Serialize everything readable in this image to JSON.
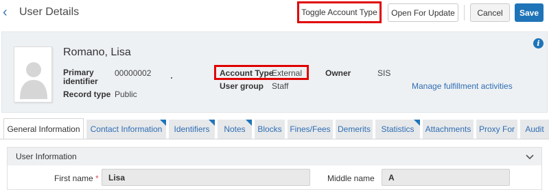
{
  "header": {
    "title": "User Details",
    "buttons": {
      "toggle": "Toggle Account Type",
      "open": "Open For Update",
      "cancel": "Cancel",
      "save": "Save"
    }
  },
  "profile": {
    "name": "Romano, Lisa",
    "fields": {
      "primary_identifier_label": "Primary identifier",
      "primary_identifier_value": "00000002",
      "record_type_label": "Record type",
      "record_type_value": "Public",
      "account_type_label": "Account Type",
      "account_type_value": "External",
      "user_group_label": "User group",
      "user_group_value": "Staff",
      "owner_label": "Owner",
      "owner_value": "SIS"
    },
    "link": "Manage fulfillment activities",
    "info_icon": "i"
  },
  "tabs": [
    {
      "label": "General Information",
      "active": true
    },
    {
      "label": "Contact Information",
      "marked": true
    },
    {
      "label": "Identifiers",
      "marked": true
    },
    {
      "label": "Notes",
      "marked": true
    },
    {
      "label": "Blocks"
    },
    {
      "label": "Fines/Fees"
    },
    {
      "label": "Demerits"
    },
    {
      "label": "Statistics",
      "marked": true
    },
    {
      "label": "Attachments"
    },
    {
      "label": "Proxy For"
    },
    {
      "label": "Audit"
    }
  ],
  "section": {
    "title": "User Information",
    "first_name_label": "First name",
    "required_mark": "*",
    "first_name_value": "Lisa",
    "middle_name_label": "Middle name",
    "middle_name_value": "A"
  },
  "colors": {
    "accent": "#1f74b8",
    "highlight": "#e00000",
    "link": "#2f6db3"
  }
}
